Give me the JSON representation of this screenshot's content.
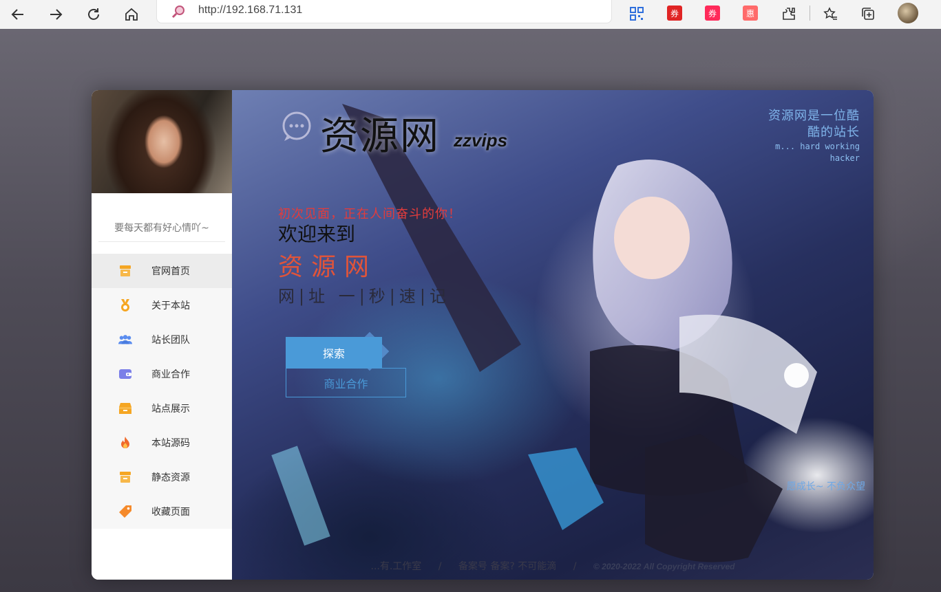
{
  "browser": {
    "url": "http://192.168.71.131",
    "ext_labels": [
      "券",
      "券",
      "惠"
    ]
  },
  "sidebar": {
    "motto": "要每天都有好心情吖~",
    "items": [
      {
        "label": "官网首页",
        "icon": "store-icon",
        "color": "#f5a623"
      },
      {
        "label": "关于本站",
        "icon": "medal-icon",
        "color": "#f5a623"
      },
      {
        "label": "站长团队",
        "icon": "team-icon",
        "color": "#5b8def"
      },
      {
        "label": "商业合作",
        "icon": "wallet-icon",
        "color": "#7b7fe8"
      },
      {
        "label": "站点展示",
        "icon": "box-icon",
        "color": "#f5a623"
      },
      {
        "label": "本站源码",
        "icon": "fire-icon",
        "color": "#f06a2b"
      },
      {
        "label": "静态资源",
        "icon": "store-icon",
        "color": "#f5a623"
      },
      {
        "label": "收藏页面",
        "icon": "tag-icon",
        "color": "#f58a2b"
      }
    ]
  },
  "hero": {
    "brand_title": "资源网",
    "brand_sub": "zzvips",
    "slogan_cn_1": "资源网是一位酷",
    "slogan_cn_2": "酷的站长",
    "slogan_en_1": "m... hard working",
    "slogan_en_2": "hacker",
    "greet": "初次见面，正在人间奋斗的你！",
    "welcome": "欢迎来到",
    "site_name": "资源网",
    "url_line": "网|址   一|秒|速|记",
    "btn_explore": "探索",
    "btn_coop": "商业合作",
    "wish": "愿成长~ 不负众望",
    "footer_studio": "...有.工作室",
    "footer_sep": "/",
    "footer_icp": "备案号 备案? 不可能滴",
    "footer_copy": "© 2020-2022 All Copyright Reserved"
  },
  "colors": {
    "accent": "#4a9ad8",
    "name_red": "#e0543a",
    "greet_red": "#e23c3c"
  }
}
